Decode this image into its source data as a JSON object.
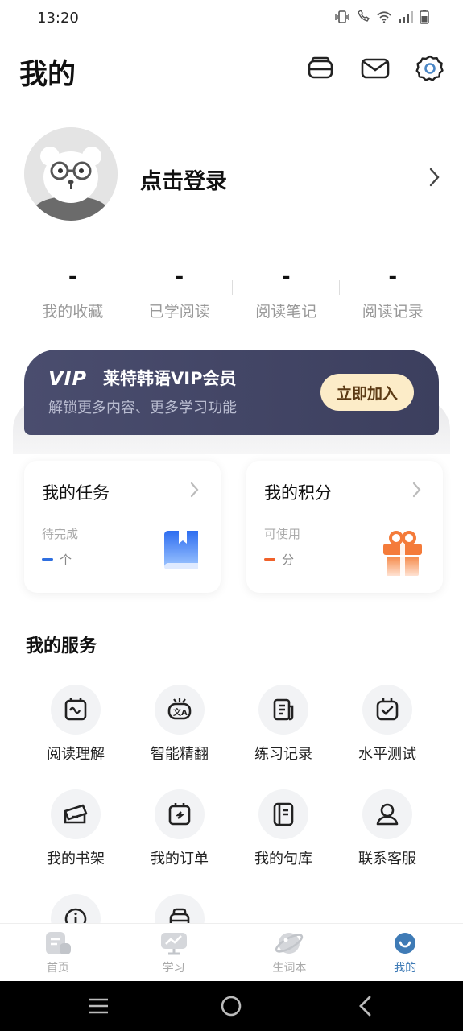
{
  "status": {
    "time": "13:20"
  },
  "header": {
    "title": "我的"
  },
  "profile": {
    "login_label": "点击登录"
  },
  "stats": [
    {
      "value": "-",
      "label": "我的收藏"
    },
    {
      "value": "-",
      "label": "已学阅读"
    },
    {
      "value": "-",
      "label": "阅读笔记"
    },
    {
      "value": "-",
      "label": "阅读记录"
    }
  ],
  "vip": {
    "logo": "VIP",
    "title": "莱特韩语VIP会员",
    "subtitle": "解锁更多内容、更多学习功能",
    "button": "立即加入"
  },
  "tasks_card": {
    "title": "我的任务",
    "subtitle": "待完成",
    "unit": "个",
    "accent": "#2f6fe0"
  },
  "points_card": {
    "title": "我的积分",
    "subtitle": "可使用",
    "unit": "分",
    "accent": "#f0612a"
  },
  "services": {
    "title": "我的服务",
    "items": [
      {
        "label": "阅读理解",
        "icon": "reading-comprehension-icon"
      },
      {
        "label": "智能精翻",
        "icon": "smart-translate-icon"
      },
      {
        "label": "练习记录",
        "icon": "practice-record-icon"
      },
      {
        "label": "水平测试",
        "icon": "level-test-icon"
      },
      {
        "label": "我的书架",
        "icon": "bookshelf-icon"
      },
      {
        "label": "我的订单",
        "icon": "order-icon"
      },
      {
        "label": "我的句库",
        "icon": "sentence-bank-icon"
      },
      {
        "label": "联系客服",
        "icon": "customer-service-icon"
      },
      {
        "label": "",
        "icon": "info-icon"
      },
      {
        "label": "",
        "icon": "box-icon"
      }
    ]
  },
  "tabs": [
    {
      "label": "首页",
      "icon": "home-icon"
    },
    {
      "label": "学习",
      "icon": "study-icon"
    },
    {
      "label": "生词本",
      "icon": "vocab-icon"
    },
    {
      "label": "我的",
      "icon": "profile-icon",
      "active": true
    }
  ],
  "colors": {
    "active_tab": "#3f7bb6",
    "vip_bg": "#4a4d6e",
    "vip_button": "#fcecc8"
  }
}
